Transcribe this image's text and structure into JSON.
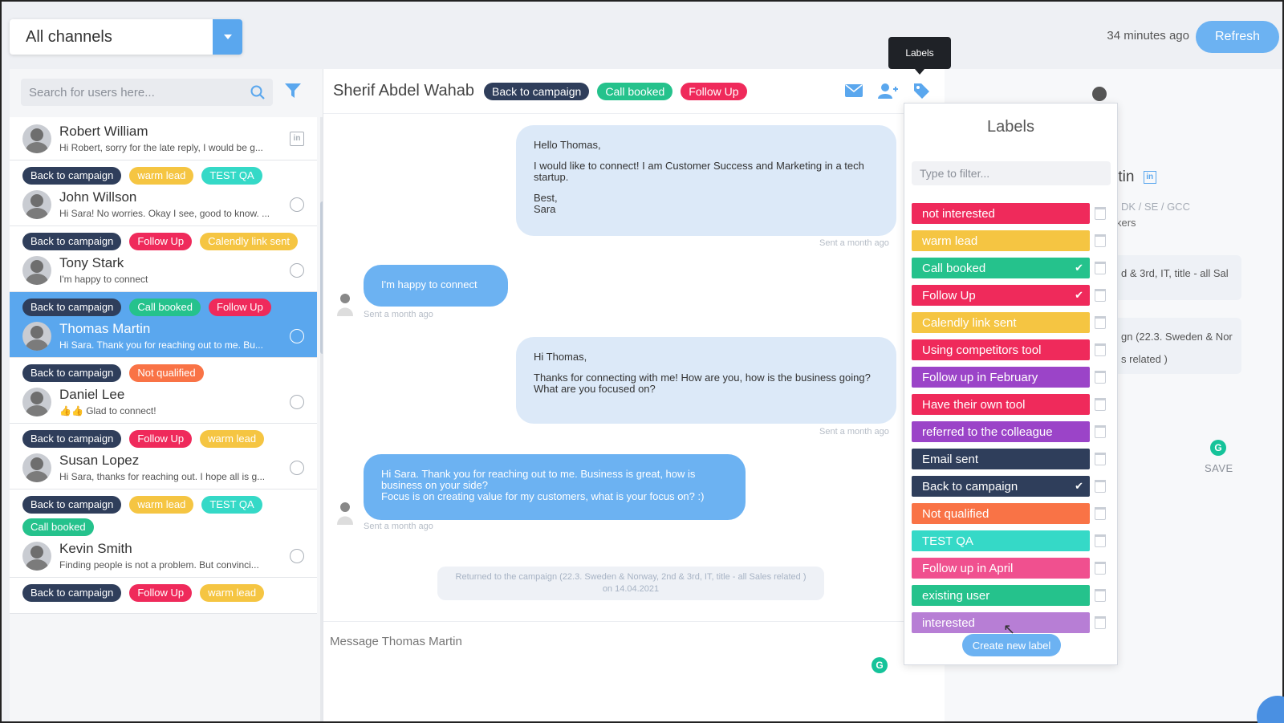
{
  "colors": {
    "navy": "#2f3e5b",
    "green": "#25c28c",
    "red": "#ef2a5b",
    "yellow": "#f5c542",
    "orange": "#f97346",
    "teal": "#35d9c7",
    "purple": "#9b44c8",
    "pink": "#f0508f",
    "lavender": "#b77ed5",
    "blue": "#6cb2f2"
  },
  "topbar": {
    "channel": "All channels",
    "time_ago": "34 minutes ago",
    "refresh_label": "Refresh"
  },
  "sidebar": {
    "search_placeholder": "Search for users here...",
    "contacts": [
      {
        "name": "Robert William",
        "preview": "Hi Robert, sorry for the late reply, I would be g...",
        "tags": [],
        "icon": "linkedin-icon"
      },
      {
        "name": "John Willson",
        "preview": "Hi Sara! No worries. Okay I see, good to know. ...",
        "tags": [
          {
            "label": "Back to campaign",
            "color": "#2f3e5b"
          },
          {
            "label": "warm lead",
            "color": "#f5c542"
          },
          {
            "label": "TEST QA",
            "color": "#35d9c7"
          }
        ],
        "icon": "compass-icon"
      },
      {
        "name": "Tony Stark",
        "preview": "I'm happy to connect",
        "tags": [
          {
            "label": "Back to campaign",
            "color": "#2f3e5b"
          },
          {
            "label": "Follow Up",
            "color": "#ef2a5b"
          },
          {
            "label": "Calendly link sent",
            "color": "#f5c542"
          }
        ],
        "icon": "compass-icon"
      },
      {
        "name": "Thomas Martin",
        "preview": "Hi Sara. Thank you for reaching out to me. Bu...",
        "tags": [
          {
            "label": "Back to campaign",
            "color": "#2f3e5b"
          },
          {
            "label": "Call booked",
            "color": "#25c28c"
          },
          {
            "label": "Follow Up",
            "color": "#ef2a5b"
          }
        ],
        "icon": "compass-icon",
        "active": true
      },
      {
        "name": "Daniel Lee",
        "preview": "👍👍 Glad to connect!",
        "tags": [
          {
            "label": "Back to campaign",
            "color": "#2f3e5b"
          },
          {
            "label": "Not qualified",
            "color": "#f97346"
          }
        ],
        "icon": "compass-icon"
      },
      {
        "name": "Susan Lopez",
        "preview": "Hi Sara, thanks for reaching out. I hope all is g...",
        "tags": [
          {
            "label": "Back to campaign",
            "color": "#2f3e5b"
          },
          {
            "label": "Follow Up",
            "color": "#ef2a5b"
          },
          {
            "label": "warm lead",
            "color": "#f5c542"
          }
        ],
        "icon": "compass-icon"
      },
      {
        "name": "Kevin Smith",
        "preview": "Finding people is not a problem. But convinci...",
        "tags": [
          {
            "label": "Back to campaign",
            "color": "#2f3e5b"
          },
          {
            "label": "warm lead",
            "color": "#f5c542"
          },
          {
            "label": "TEST QA",
            "color": "#35d9c7"
          },
          {
            "label": "Call booked",
            "color": "#25c28c"
          }
        ],
        "icon": "compass-icon"
      },
      {
        "name": "",
        "preview": "",
        "tags": [
          {
            "label": "Back to campaign",
            "color": "#2f3e5b"
          },
          {
            "label": "Follow Up",
            "color": "#ef2a5b"
          },
          {
            "label": "warm lead",
            "color": "#f5c542"
          }
        ],
        "icon": ""
      }
    ]
  },
  "chat": {
    "contact_name": "Sherif Abdel Wahab",
    "header_tags": [
      {
        "label": "Back to campaign",
        "color": "#2f3e5b"
      },
      {
        "label": "Call booked",
        "color": "#25c28c"
      },
      {
        "label": "Follow Up",
        "color": "#ef2a5b"
      }
    ],
    "tooltip": "Labels",
    "messages": [
      {
        "paragraphs": [
          "Hello Thomas,",
          "I would like to connect! I am Customer Success and Marketing in a tech startup.",
          "Best,\nSara"
        ],
        "stamp": "Sent a month ago"
      },
      {
        "paragraphs": [
          "I'm happy to connect"
        ],
        "stamp": "Sent a month ago"
      },
      {
        "paragraphs": [
          "Hi Thomas,",
          "Thanks for connecting with me! How are you, how is the business going?\nWhat are you focused on?"
        ],
        "stamp": "Sent a month ago"
      },
      {
        "paragraphs": [
          "Hi Sara. Thank you for reaching out to me. Business is great, how is business on your side?\nFocus is on creating value for my customers, what is your focus on? :)"
        ],
        "stamp": "Sent a month ago"
      }
    ],
    "note": "Returned to the campaign (22.3. Sweden & Norway, 2nd & 3rd, IT, title - all Sales related )\non 14.04.2021",
    "composer_placeholder": "Message Thomas Martin"
  },
  "profile": {
    "name_fragment": "rtin",
    "line1": "DK / SE / GCC",
    "line2": "kers",
    "card1": "d & 3rd, IT, title - all Sal",
    "card2_a": "gn (22.3. Sweden & Nor",
    "card2_b": "s related )",
    "save_label": "SAVE"
  },
  "labels_panel": {
    "title": "Labels",
    "filter_placeholder": "Type to filter...",
    "create_label": "Create new label",
    "labels": [
      {
        "label": "not interested",
        "color": "#ef2a5b",
        "checked": false
      },
      {
        "label": "warm lead",
        "color": "#f5c542",
        "checked": false
      },
      {
        "label": "Call booked",
        "color": "#25c28c",
        "checked": true
      },
      {
        "label": "Follow Up",
        "color": "#ef2a5b",
        "checked": true
      },
      {
        "label": "Calendly link sent",
        "color": "#f5c542",
        "checked": false
      },
      {
        "label": "Using competitors tool",
        "color": "#ef2a5b",
        "checked": false
      },
      {
        "label": "Follow up in February",
        "color": "#9b44c8",
        "checked": false
      },
      {
        "label": "Have their own tool",
        "color": "#ef2a5b",
        "checked": false
      },
      {
        "label": "referred to the colleague",
        "color": "#9b44c8",
        "checked": false
      },
      {
        "label": "Email sent",
        "color": "#2f3e5b",
        "checked": false
      },
      {
        "label": "Back to campaign",
        "color": "#2f3e5b",
        "checked": true
      },
      {
        "label": "Not qualified",
        "color": "#f97346",
        "checked": false
      },
      {
        "label": "TEST QA",
        "color": "#35d9c7",
        "checked": false
      },
      {
        "label": "Follow up in April",
        "color": "#f0508f",
        "checked": false
      },
      {
        "label": "existing user",
        "color": "#25c28c",
        "checked": false
      },
      {
        "label": "interested",
        "color": "#b77ed5",
        "checked": false
      }
    ]
  }
}
